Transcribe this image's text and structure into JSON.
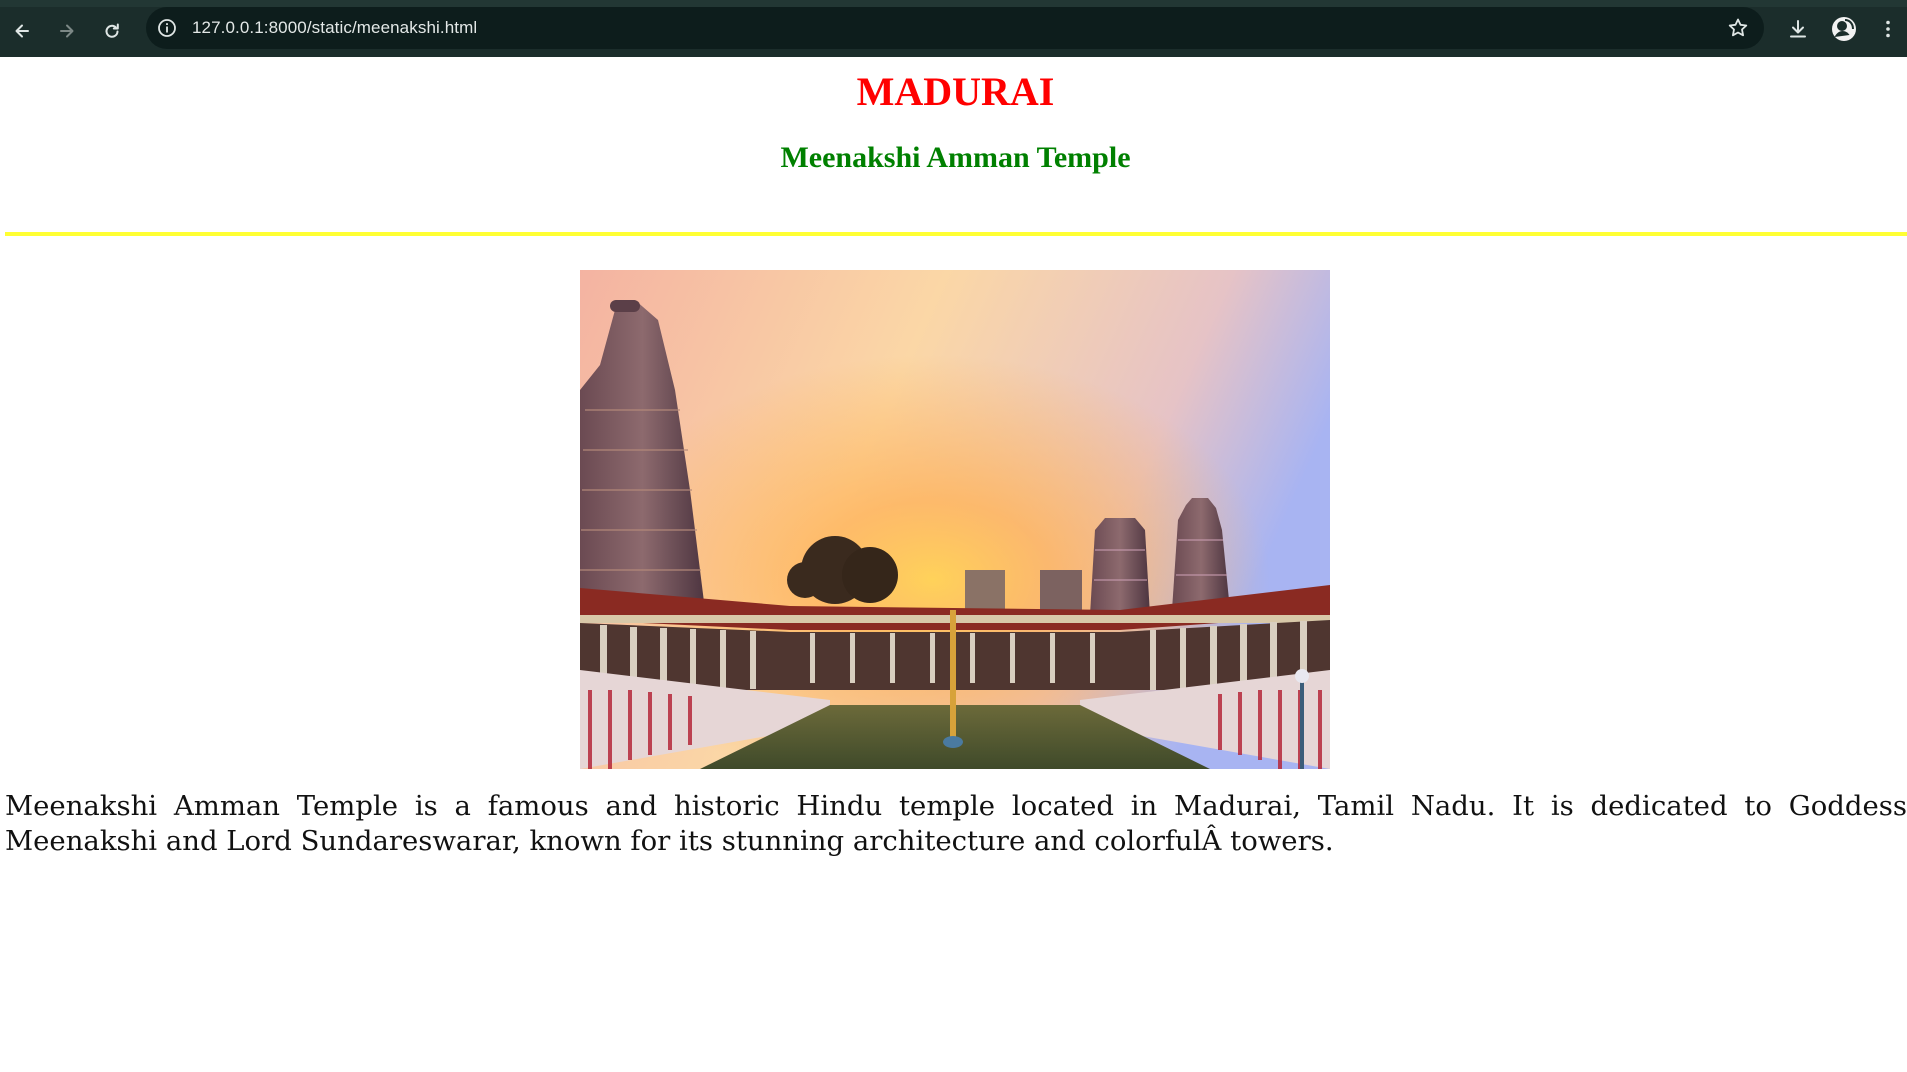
{
  "browser": {
    "url": "127.0.0.1:8000/static/meenakshi.html",
    "colors": {
      "frame": "#1b2d2b",
      "omnibox": "#0d1d1c",
      "text": "#e3e8e7"
    }
  },
  "page": {
    "title": "MADURAI",
    "subtitle": "Meenakshi Amman Temple",
    "image_icon": "temple-photo",
    "description": "Meenakshi Amman Temple is a famous and historic Hindu temple located in Madurai, Tamil Nadu. It is dedicated to Goddess Meenakshi and Lord Sundareswarar, known for its stunning architecture and colorfulÂ towers.",
    "colors": {
      "title": "#ff0000",
      "subtitle": "#008000",
      "rule": "#ffff33"
    }
  }
}
